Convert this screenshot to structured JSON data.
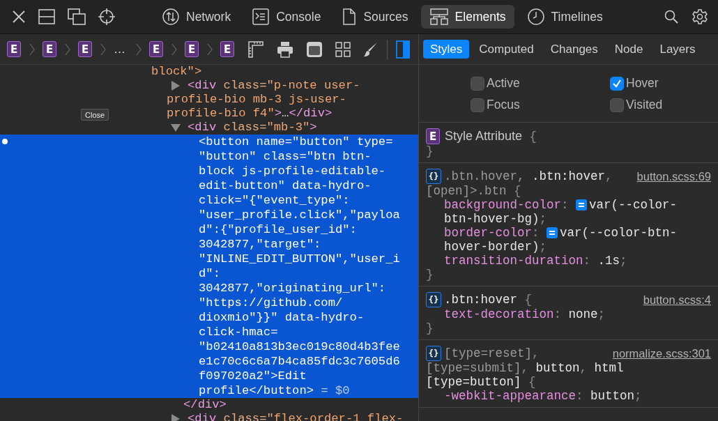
{
  "toolbar": {
    "tabs": [
      {
        "label": "Network",
        "selected": false
      },
      {
        "label": "Console",
        "selected": false
      },
      {
        "label": "Sources",
        "selected": false
      },
      {
        "label": "Elements",
        "selected": true
      },
      {
        "label": "Timelines",
        "selected": false
      }
    ]
  },
  "breadcrumbs": [
    {
      "kind": "badge",
      "text": "E"
    },
    {
      "kind": "badge",
      "text": "E"
    },
    {
      "kind": "badge",
      "text": "E"
    },
    {
      "kind": "ellipsis",
      "text": "…"
    },
    {
      "kind": "badge",
      "text": "E"
    },
    {
      "kind": "badge",
      "text": "E"
    },
    {
      "kind": "badge",
      "text": "E"
    }
  ],
  "details_sidebar": {
    "on": true
  },
  "overlay_button": {
    "label": "Close"
  },
  "dom_tree": [
    {
      "selected": false,
      "lines": [
        [
          {
            "kind": "value",
            "text": "block\">"
          }
        ]
      ],
      "children": [
        {
          "selected": false,
          "expanded": false,
          "lines": [
            [
              {
                "kind": "tag",
                "text": "<div"
              },
              {
                "kind": "attr",
                "text": " class="
              },
              {
                "kind": "value",
                "text": "\"p-note user-"
              }
            ],
            [
              {
                "kind": "value",
                "text": "profile-bio mb-3 js-user-"
              }
            ],
            [
              {
                "kind": "value",
                "text": "profile-bio f4\""
              },
              {
                "kind": "tag",
                "text": ">"
              },
              {
                "kind": "text",
                "text": "…"
              },
              {
                "kind": "tag",
                "text": "</div>"
              }
            ]
          ]
        },
        {
          "selected": false,
          "expanded": true,
          "lines": [
            [
              {
                "kind": "tag",
                "text": "<div"
              },
              {
                "kind": "attr",
                "text": " class="
              },
              {
                "kind": "value",
                "text": "\"mb-3\""
              },
              {
                "kind": "tag",
                "text": ">"
              }
            ]
          ],
          "children": [
            {
              "selected": true,
              "lines": [
                [
                  {
                    "kind": "tag",
                    "text": "<button"
                  },
                  {
                    "kind": "attr",
                    "text": " name="
                  },
                  {
                    "kind": "value",
                    "text": "\"button\""
                  },
                  {
                    "kind": "attr",
                    "text": " type="
                  }
                ],
                [
                  {
                    "kind": "value",
                    "text": "\"button\""
                  },
                  {
                    "kind": "attr",
                    "text": " class="
                  },
                  {
                    "kind": "value",
                    "text": "\"btn btn-"
                  }
                ],
                [
                  {
                    "kind": "value",
                    "text": "block js-profile-editable-"
                  }
                ],
                [
                  {
                    "kind": "value",
                    "text": "edit-button\""
                  },
                  {
                    "kind": "attr",
                    "text": " data-hydro-"
                  }
                ],
                [
                  {
                    "kind": "attr",
                    "text": "click="
                  },
                  {
                    "kind": "value",
                    "text": "\"{\"event_type\":"
                  }
                ],
                [
                  {
                    "kind": "value",
                    "text": "\"user_profile.click\",\"payloa"
                  }
                ],
                [
                  {
                    "kind": "value",
                    "text": "d\":{\"profile_user_id\":"
                  }
                ],
                [
                  {
                    "kind": "value",
                    "text": "3042877,\"target\":"
                  }
                ],
                [
                  {
                    "kind": "value",
                    "text": "\"INLINE_EDIT_BUTTON\",\"user_i"
                  }
                ],
                [
                  {
                    "kind": "value",
                    "text": "d\":"
                  }
                ],
                [
                  {
                    "kind": "value",
                    "text": "3042877,\"originating_url\":"
                  }
                ],
                [
                  {
                    "kind": "value",
                    "text": "\"https://github.com/"
                  }
                ],
                [
                  {
                    "kind": "value",
                    "text": "dioxmio\"}}\""
                  },
                  {
                    "kind": "attr",
                    "text": " data-hydro-"
                  }
                ],
                [
                  {
                    "kind": "attr",
                    "text": "click-hmac="
                  }
                ],
                [
                  {
                    "kind": "value",
                    "text": "\"b02410a813b3ec019c80d4b3fee"
                  }
                ],
                [
                  {
                    "kind": "value",
                    "text": "e1c70c6c6a7b4ca85fdc3c7605d6"
                  }
                ],
                [
                  {
                    "kind": "value",
                    "text": "f097020a2\""
                  },
                  {
                    "kind": "tag",
                    "text": ">"
                  },
                  {
                    "kind": "text",
                    "text": "Edit"
                  }
                ],
                [
                  {
                    "kind": "text",
                    "text": "profile"
                  },
                  {
                    "kind": "tag",
                    "text": "</button>"
                  },
                  {
                    "kind": "ref",
                    "text": " = $0"
                  }
                ]
              ]
            }
          ],
          "closing": [
            [
              {
                "kind": "tag",
                "text": "</div>"
              }
            ]
          ]
        },
        {
          "selected": false,
          "expanded": false,
          "lines": [
            [
              {
                "kind": "tag",
                "text": "<div"
              },
              {
                "kind": "attr",
                "text": " class="
              },
              {
                "kind": "value",
                "text": "\"flex-order-1 flex-"
              }
            ]
          ]
        }
      ]
    }
  ],
  "sidebar_tabs": [
    {
      "label": "Styles",
      "selected": true
    },
    {
      "label": "Computed",
      "selected": false
    },
    {
      "label": "Changes",
      "selected": false
    },
    {
      "label": "Node",
      "selected": false
    },
    {
      "label": "Layers",
      "selected": false
    }
  ],
  "pseudo_classes": [
    {
      "label": "Active",
      "checked": false
    },
    {
      "label": "Hover",
      "checked": true
    },
    {
      "label": "Focus",
      "checked": false
    },
    {
      "label": "Visited",
      "checked": false
    }
  ],
  "rules": [
    {
      "lines": [
        {
          "indented": false,
          "tokens": [
            {
              "kind": "element-badge",
              "text": "E"
            },
            {
              "kind": "title",
              "text": "Style Attribute"
            },
            {
              "kind": "punct",
              "text": " {"
            }
          ]
        },
        {
          "indented": false,
          "tokens": [
            {
              "kind": "punct",
              "text": "}"
            }
          ]
        }
      ]
    },
    {
      "lines": [
        {
          "indented": false,
          "tokens": [
            {
              "kind": "rule-badge",
              "text": "{}"
            },
            {
              "kind": "selector-dim",
              "text": ".btn.hover, "
            },
            {
              "kind": "selector",
              "text": ".btn:hover"
            },
            {
              "kind": "punct",
              "text": ","
            },
            {
              "kind": "source",
              "text": "button.scss:69"
            }
          ]
        },
        {
          "indented": false,
          "tokens": [
            {
              "kind": "selector-dim",
              "text": "[open]>.btn"
            },
            {
              "kind": "punct",
              "text": " {"
            }
          ]
        },
        {
          "indented": true,
          "tokens": [
            {
              "kind": "prop",
              "text": "background-color"
            },
            {
              "kind": "punct",
              "text": ": "
            },
            {
              "kind": "variable"
            },
            {
              "kind": "value",
              "text": "var(--color-"
            }
          ]
        },
        {
          "indented": true,
          "tokens": [
            {
              "kind": "value",
              "text": "btn-hover-bg)"
            },
            {
              "kind": "punct",
              "text": ";"
            }
          ]
        },
        {
          "indented": true,
          "tokens": [
            {
              "kind": "prop",
              "text": "border-color"
            },
            {
              "kind": "punct",
              "text": ": "
            },
            {
              "kind": "variable"
            },
            {
              "kind": "value",
              "text": "var(--color-btn-"
            }
          ]
        },
        {
          "indented": true,
          "tokens": [
            {
              "kind": "value",
              "text": "hover-border)"
            },
            {
              "kind": "punct",
              "text": ";"
            }
          ]
        },
        {
          "indented": true,
          "tokens": [
            {
              "kind": "prop",
              "text": "transition-duration"
            },
            {
              "kind": "punct",
              "text": ": "
            },
            {
              "kind": "value",
              "text": ".1s"
            },
            {
              "kind": "punct",
              "text": ";"
            }
          ]
        },
        {
          "indented": false,
          "tokens": [
            {
              "kind": "punct",
              "text": "}"
            }
          ]
        }
      ]
    },
    {
      "lines": [
        {
          "indented": false,
          "tokens": [
            {
              "kind": "rule-badge",
              "text": "{}"
            },
            {
              "kind": "selector",
              "text": ".btn:hover"
            },
            {
              "kind": "punct",
              "text": " {"
            },
            {
              "kind": "source",
              "text": "button.scss:4"
            }
          ]
        },
        {
          "indented": true,
          "tokens": [
            {
              "kind": "prop",
              "text": "text-decoration"
            },
            {
              "kind": "punct",
              "text": ": "
            },
            {
              "kind": "value",
              "text": "none"
            },
            {
              "kind": "punct",
              "text": ";"
            }
          ]
        },
        {
          "indented": false,
          "tokens": [
            {
              "kind": "punct",
              "text": "}"
            }
          ]
        }
      ]
    },
    {
      "lines": [
        {
          "indented": false,
          "tokens": [
            {
              "kind": "rule-badge",
              "text": "{}"
            },
            {
              "kind": "selector-dim",
              "text": "[type=reset]"
            },
            {
              "kind": "punct",
              "text": ","
            },
            {
              "kind": "source",
              "text": "normalize.scss:301"
            }
          ]
        },
        {
          "indented": false,
          "tokens": [
            {
              "kind": "selector-dim",
              "text": "[type=submit]"
            },
            {
              "kind": "punct",
              "text": ", "
            },
            {
              "kind": "selector",
              "text": "button"
            },
            {
              "kind": "punct",
              "text": ", "
            },
            {
              "kind": "selector",
              "text": "html"
            }
          ]
        },
        {
          "indented": false,
          "tokens": [
            {
              "kind": "selector",
              "text": "[type=button]"
            },
            {
              "kind": "punct",
              "text": " {"
            }
          ]
        },
        {
          "indented": true,
          "tokens": [
            {
              "kind": "prop",
              "text": "-webkit-appearance"
            },
            {
              "kind": "punct",
              "text": ": "
            },
            {
              "kind": "value",
              "text": "button"
            },
            {
              "kind": "punct",
              "text": ";"
            }
          ]
        }
      ]
    }
  ]
}
